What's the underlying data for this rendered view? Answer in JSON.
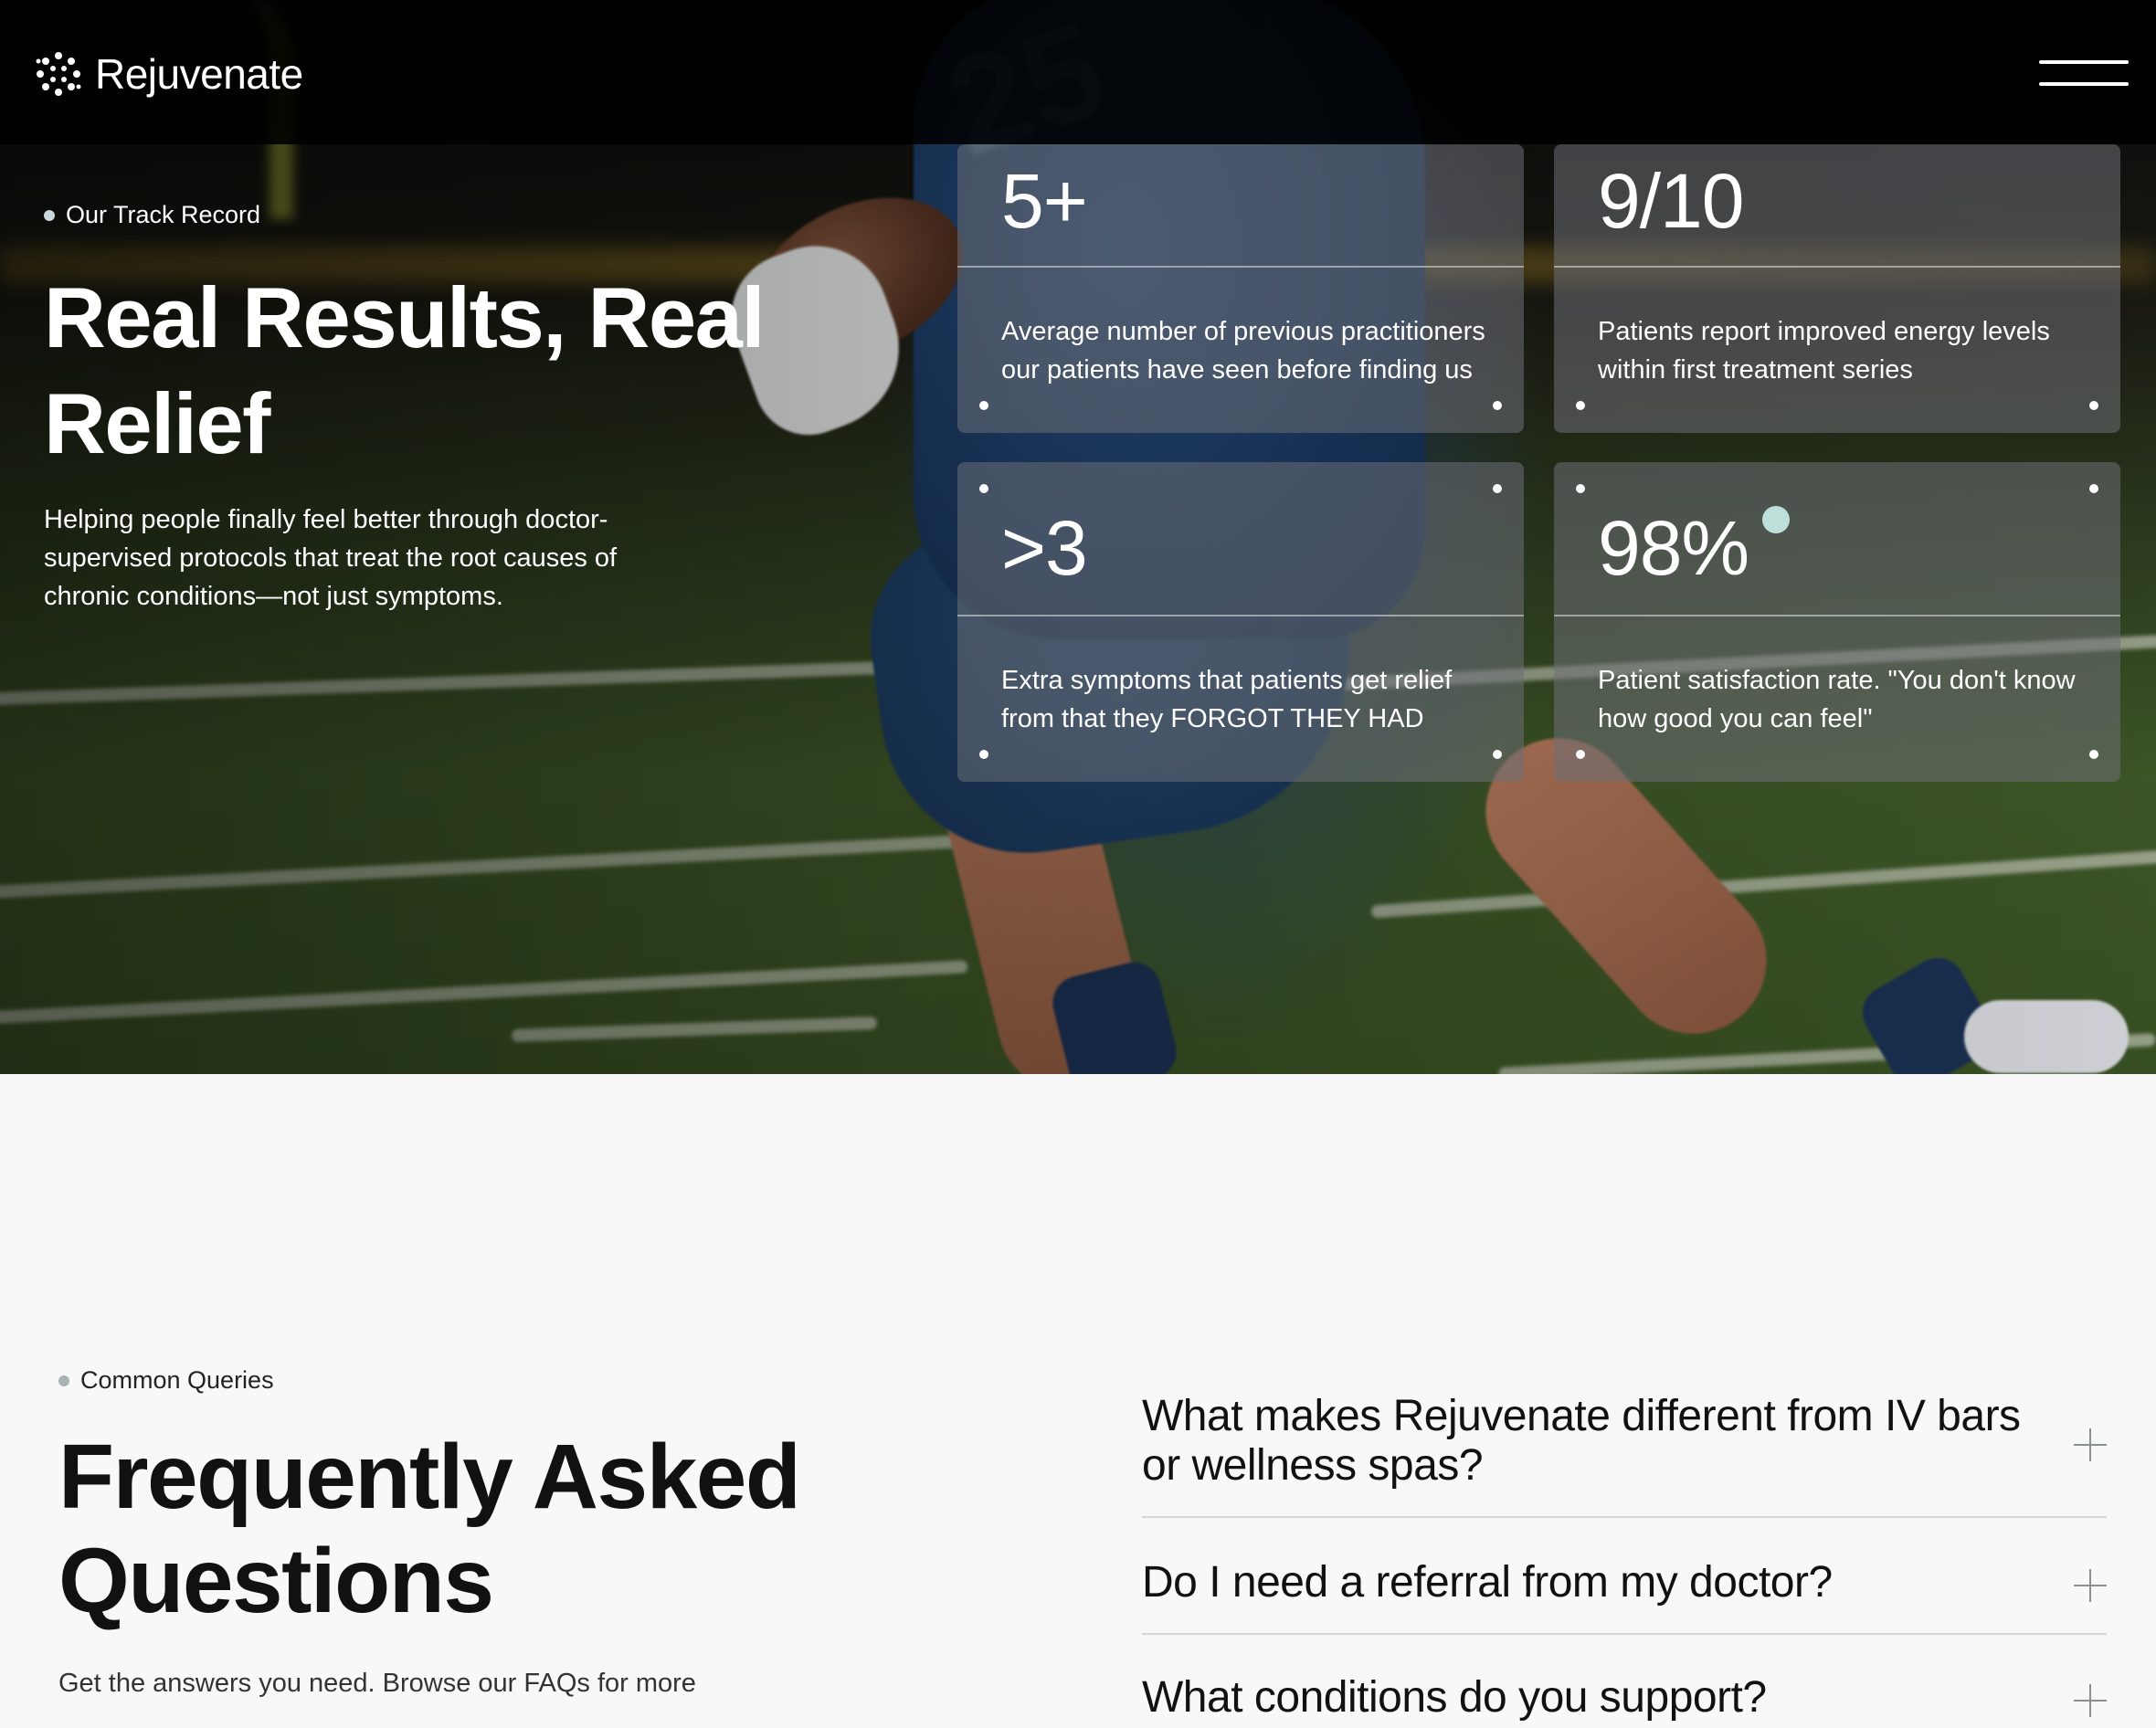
{
  "brand": {
    "name": "Rejuvenate"
  },
  "nav": {
    "menu_icon": "hamburger-menu-icon"
  },
  "hero": {
    "eyebrow": "Our Track Record",
    "title": "Real Results, Real Relief",
    "subtitle": "Helping people finally feel better through doctor-supervised protocols that treat the root causes of chronic conditions—not just symptoms."
  },
  "stats": [
    {
      "value": "5+",
      "description": "Average number of previous practitioners our patients have seen before finding us"
    },
    {
      "value": "9/10",
      "description": "Patients report improved energy levels within first treatment series"
    },
    {
      "value": ">3",
      "description": "Extra symptoms that patients get relief from that they FORGOT THEY HAD"
    },
    {
      "value": "98%",
      "description": "Patient satisfaction rate. \"You don't know how good you can feel\""
    }
  ],
  "faq": {
    "eyebrow": "Common Queries",
    "title": "Frequently Asked Questions",
    "subtitle": "Get the answers you need. Browse our FAQs for more",
    "items": [
      {
        "question": "What makes Rejuvenate different from IV bars or wellness spas?"
      },
      {
        "question": "Do I need a referral from my doctor?"
      },
      {
        "question": "What conditions do you support?"
      }
    ]
  },
  "colors": {
    "accent_dot": "#bfe0da",
    "card_bg": "rgba(110,112,118,0.55)",
    "page_bg": "#f8f8f8"
  }
}
